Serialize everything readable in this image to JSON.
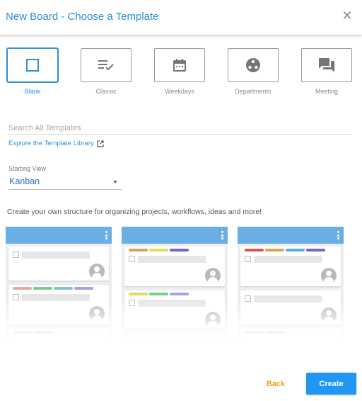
{
  "dialog": {
    "title": "New Board - Choose a Template",
    "close_icon": "close-icon",
    "accent_color": "#2d8fd8"
  },
  "templates": [
    {
      "label": "Blank",
      "icon": "square-icon",
      "selected": true
    },
    {
      "label": "Classic",
      "icon": "checklist-icon",
      "selected": false
    },
    {
      "label": "Weekdays",
      "icon": "calendar-icon",
      "selected": false
    },
    {
      "label": "Departments",
      "icon": "departments-icon",
      "selected": false
    },
    {
      "label": "Meeting",
      "icon": "chat-icon",
      "selected": false
    }
  ],
  "search": {
    "placeholder": "Search All Templates",
    "value": ""
  },
  "explore": {
    "label": "Explore the Template Library",
    "icon": "external-link-icon"
  },
  "starting_view": {
    "label": "Starting View",
    "value": "Kanban"
  },
  "description": "Create your own structure for organizing projects, workflows, ideas and more!",
  "preview": {
    "header_color": "#6aaee6",
    "tag_colors": {
      "orange": "#d9a55a",
      "yellow": "#dede5a",
      "purple": "#7a63c9",
      "red": "#d9575b",
      "blue": "#5aaee6",
      "green": "#7ccc8e",
      "teal": "#7fc6c6",
      "lavender": "#a9a2de",
      "pink": "#e6a9a6"
    }
  },
  "actions": {
    "back_label": "Back",
    "back_color": "#f0a020",
    "create_label": "Create",
    "create_color": "#2196f3"
  }
}
